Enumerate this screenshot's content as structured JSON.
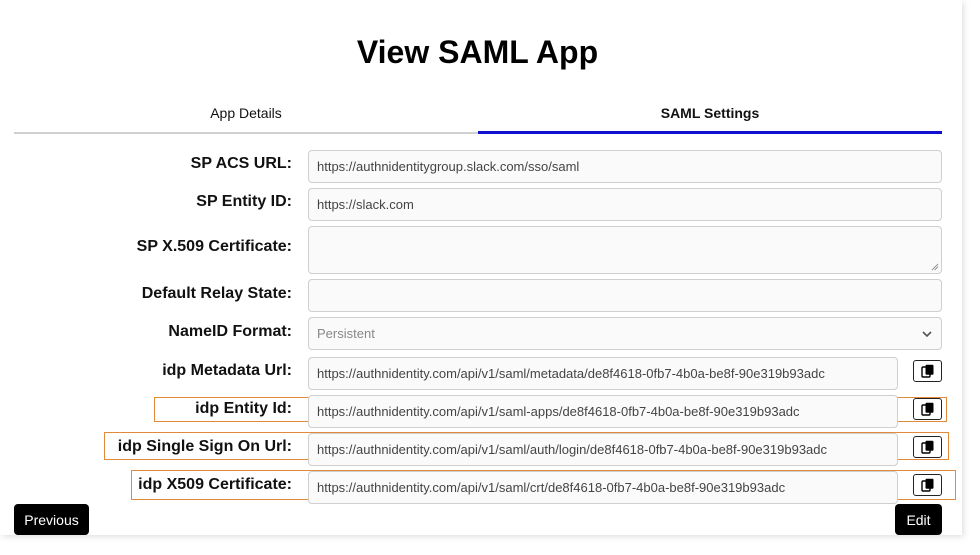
{
  "page": {
    "title": "View SAML App"
  },
  "tabs": [
    {
      "label": "App Details",
      "active": false
    },
    {
      "label": "SAML Settings",
      "active": true
    }
  ],
  "form": {
    "sp_acs_url": {
      "label": "SP ACS URL:",
      "value": "https://authnidentitygroup.slack.com/sso/saml"
    },
    "sp_entity_id": {
      "label": "SP Entity ID:",
      "value": "https://slack.com"
    },
    "sp_x509": {
      "label": "SP X.509 Certificate:",
      "value": ""
    },
    "relay_state": {
      "label": "Default Relay State:",
      "value": ""
    },
    "nameid_format": {
      "label": "NameID Format:",
      "value": "Persistent"
    },
    "idp_metadata_url": {
      "label": "idp Metadata Url:",
      "value": "https://authnidentity.com/api/v1/saml/metadata/de8f4618-0fb7-4b0a-be8f-90e319b93adc"
    },
    "idp_entity_id": {
      "label": "idp Entity Id:",
      "value": "https://authnidentity.com/api/v1/saml-apps/de8f4618-0fb7-4b0a-be8f-90e319b93adc"
    },
    "idp_sso_url": {
      "label": "idp Single Sign On Url:",
      "value": "https://authnidentity.com/api/v1/saml/auth/login/de8f4618-0fb7-4b0a-be8f-90e319b93adc"
    },
    "idp_x509": {
      "label": "idp X509 Certificate:",
      "value": "https://authnidentity.com/api/v1/saml/crt/de8f4618-0fb7-4b0a-be8f-90e319b93adc"
    }
  },
  "buttons": {
    "previous": "Previous",
    "edit": "Edit"
  },
  "colors": {
    "active_tab": "#1010d0",
    "highlight": "#e08a3a",
    "button_bg": "#000000"
  },
  "icons": {
    "copy": "copy-icon",
    "select": "chevron-down-icon"
  }
}
